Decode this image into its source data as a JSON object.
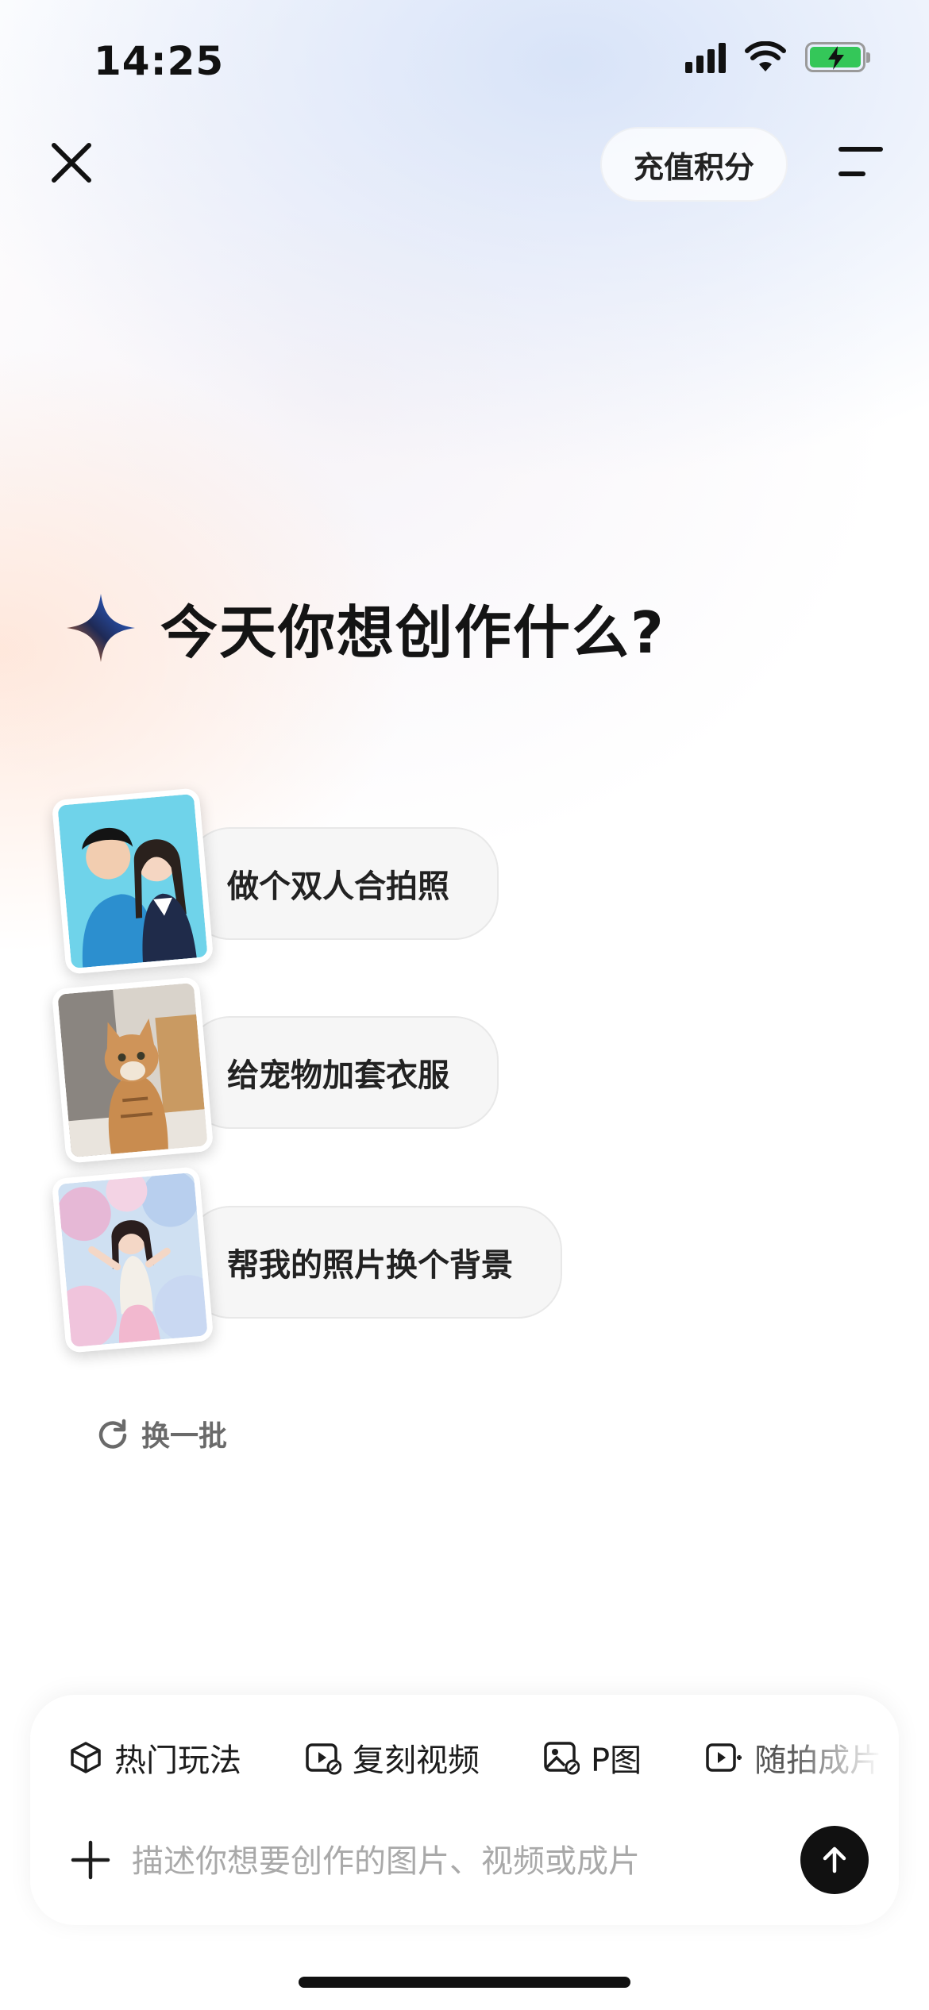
{
  "status_bar": {
    "time": "14:25"
  },
  "header": {
    "recharge_label": "充值积分"
  },
  "main": {
    "heading": "今天你想创作什么?",
    "suggestions": [
      {
        "label": "做个双人合拍照",
        "thumb": "couple-photo"
      },
      {
        "label": "给宠物加套衣服",
        "thumb": "cat-photo"
      },
      {
        "label": "帮我的照片换个背景",
        "thumb": "girl-clouds-photo"
      }
    ],
    "refresh_label": "换一批"
  },
  "composer": {
    "tools": [
      {
        "label": "热门玩法",
        "icon": "cube-icon"
      },
      {
        "label": "复刻视频",
        "icon": "video-edit-icon"
      },
      {
        "label": "P图",
        "icon": "image-edit-icon"
      },
      {
        "label": "随拍成片",
        "icon": "video-play-icon"
      }
    ],
    "placeholder": "描述你想要创作的图片、视频或成片"
  },
  "colors": {
    "accent_blue": "#2f6ff0",
    "accent_orange": "#f07a2a",
    "battery_green": "#34c759"
  }
}
